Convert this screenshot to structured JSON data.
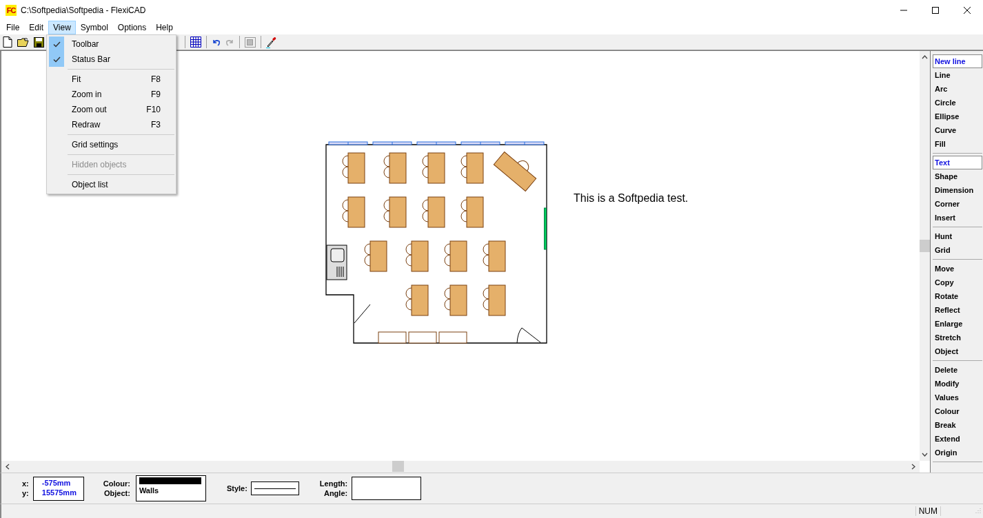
{
  "window": {
    "app_icon": "FC",
    "title": "C:\\Softpedia\\Softpedia - FlexiCAD"
  },
  "menu_bar": [
    {
      "label": "File",
      "selected": false
    },
    {
      "label": "Edit",
      "selected": false
    },
    {
      "label": "View",
      "selected": true
    },
    {
      "label": "Symbol",
      "selected": false
    },
    {
      "label": "Options",
      "selected": false
    },
    {
      "label": "Help",
      "selected": false
    }
  ],
  "toolbar": [
    {
      "kind": "new",
      "disabled": false
    },
    {
      "kind": "open",
      "disabled": false
    },
    {
      "kind": "save",
      "disabled": false
    },
    {
      "kind": "grid",
      "disabled": false
    },
    {
      "kind": "undo",
      "disabled": false
    },
    {
      "kind": "redo",
      "disabled": true
    },
    {
      "kind": "copy",
      "disabled": true
    },
    {
      "kind": "picker",
      "disabled": false
    }
  ],
  "view_menu": [
    [
      {
        "label": "Toolbar",
        "checked": true,
        "disabled": false
      },
      {
        "label": "Status Bar",
        "checked": true,
        "disabled": false
      }
    ],
    [
      {
        "label": "Fit",
        "shortcut": "F8",
        "checked": false,
        "disabled": false
      },
      {
        "label": "Zoom in",
        "shortcut": "F9",
        "checked": false,
        "disabled": false
      },
      {
        "label": "Zoom out",
        "shortcut": "F10",
        "checked": false,
        "disabled": false
      },
      {
        "label": "Redraw",
        "shortcut": "F3",
        "checked": false,
        "disabled": false
      }
    ],
    [
      {
        "label": "Grid settings",
        "checked": false,
        "disabled": false
      }
    ],
    [
      {
        "label": "Hidden objects",
        "checked": false,
        "disabled": true
      }
    ],
    [
      {
        "label": "Object list",
        "checked": false,
        "disabled": false
      }
    ]
  ],
  "canvas": {
    "text": "This is a Softpedia test."
  },
  "commands": [
    [
      {
        "label": "New line",
        "selected": true
      },
      {
        "label": "Line",
        "selected": false
      },
      {
        "label": "Arc",
        "selected": false
      },
      {
        "label": "Circle",
        "selected": false
      },
      {
        "label": "Ellipse",
        "selected": false
      },
      {
        "label": "Curve",
        "selected": false
      },
      {
        "label": "Fill",
        "selected": false
      }
    ],
    [
      {
        "label": "Text",
        "selected": true
      },
      {
        "label": "Shape",
        "selected": false
      },
      {
        "label": "Dimension",
        "selected": false
      },
      {
        "label": "Corner",
        "selected": false
      },
      {
        "label": "Insert",
        "selected": false
      }
    ],
    [
      {
        "label": "Hunt",
        "selected": false
      },
      {
        "label": "Grid",
        "selected": false
      }
    ],
    [
      {
        "label": "Move",
        "selected": false
      },
      {
        "label": "Copy",
        "selected": false
      },
      {
        "label": "Rotate",
        "selected": false
      },
      {
        "label": "Reflect",
        "selected": false
      },
      {
        "label": "Enlarge",
        "selected": false
      },
      {
        "label": "Stretch",
        "selected": false
      },
      {
        "label": "Object",
        "selected": false
      }
    ],
    [
      {
        "label": "Delete",
        "selected": false
      },
      {
        "label": "Modify",
        "selected": false
      },
      {
        "label": "Values",
        "selected": false
      },
      {
        "label": "Colour",
        "selected": false
      },
      {
        "label": "Break",
        "selected": false
      },
      {
        "label": "Extend",
        "selected": false
      },
      {
        "label": "Origin",
        "selected": false
      }
    ]
  ],
  "info_panel": {
    "x_label": "x:",
    "x_value": "-575mm",
    "y_label": "y:",
    "y_value": "15575mm",
    "colour_label": "Colour:",
    "colour_swatch": {
      "color": "#000000"
    },
    "object_label": "Object:",
    "object_value": "Walls",
    "style_label": "Style:",
    "length_label": "Length:",
    "angle_label": "Angle:"
  },
  "status_bar": [
    "NUM"
  ]
}
